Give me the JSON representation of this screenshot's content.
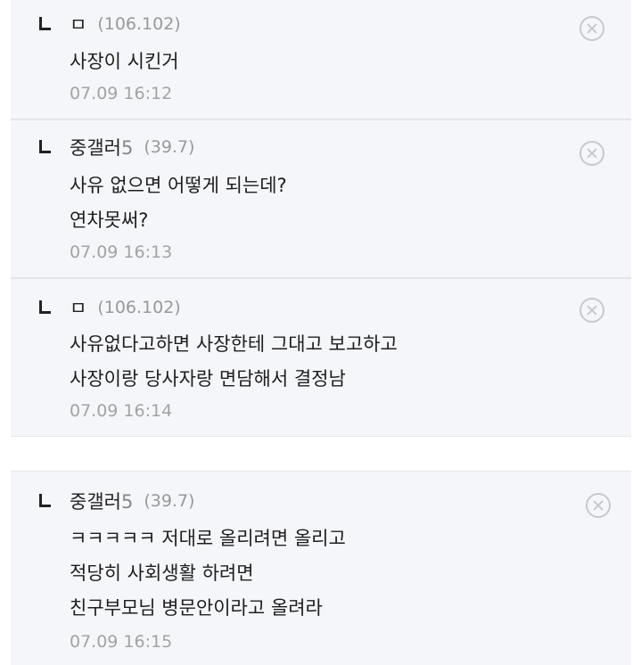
{
  "comments": [
    {
      "author": "ㅁ",
      "author_num": "",
      "ip": "(106.102)",
      "lines": [
        "사장이 시킨거"
      ],
      "time": "07.09 16:12"
    },
    {
      "author": "중갤러",
      "author_num": "5",
      "ip": "(39.7)",
      "lines": [
        "사유 없으면 어떻게 되는데?",
        "연차못써?"
      ],
      "time": "07.09 16:13"
    },
    {
      "author": "ㅁ",
      "author_num": "",
      "ip": "(106.102)",
      "lines": [
        "사유없다고하면 사장한테 그대고 보고하고",
        "사장이랑 당사자랑 면담해서 결정남"
      ],
      "time": "07.09 16:14"
    },
    {
      "author": "중갤러",
      "author_num": "5",
      "ip": "(39.7)",
      "lines": [
        "ㅋㅋㅋㅋㅋ 저대로 올리려면 올리고",
        "적당히 사회생활 하려면",
        "친구부모님 병문안이라고 올려라"
      ],
      "time": "07.09 16:15"
    }
  ],
  "icons": {
    "reply": "reply-arrow-icon",
    "delete": "close-circle-icon"
  },
  "colors": {
    "background": "#f5f6f9",
    "text": "#1e1e1e",
    "meta": "#a3a3a3"
  }
}
